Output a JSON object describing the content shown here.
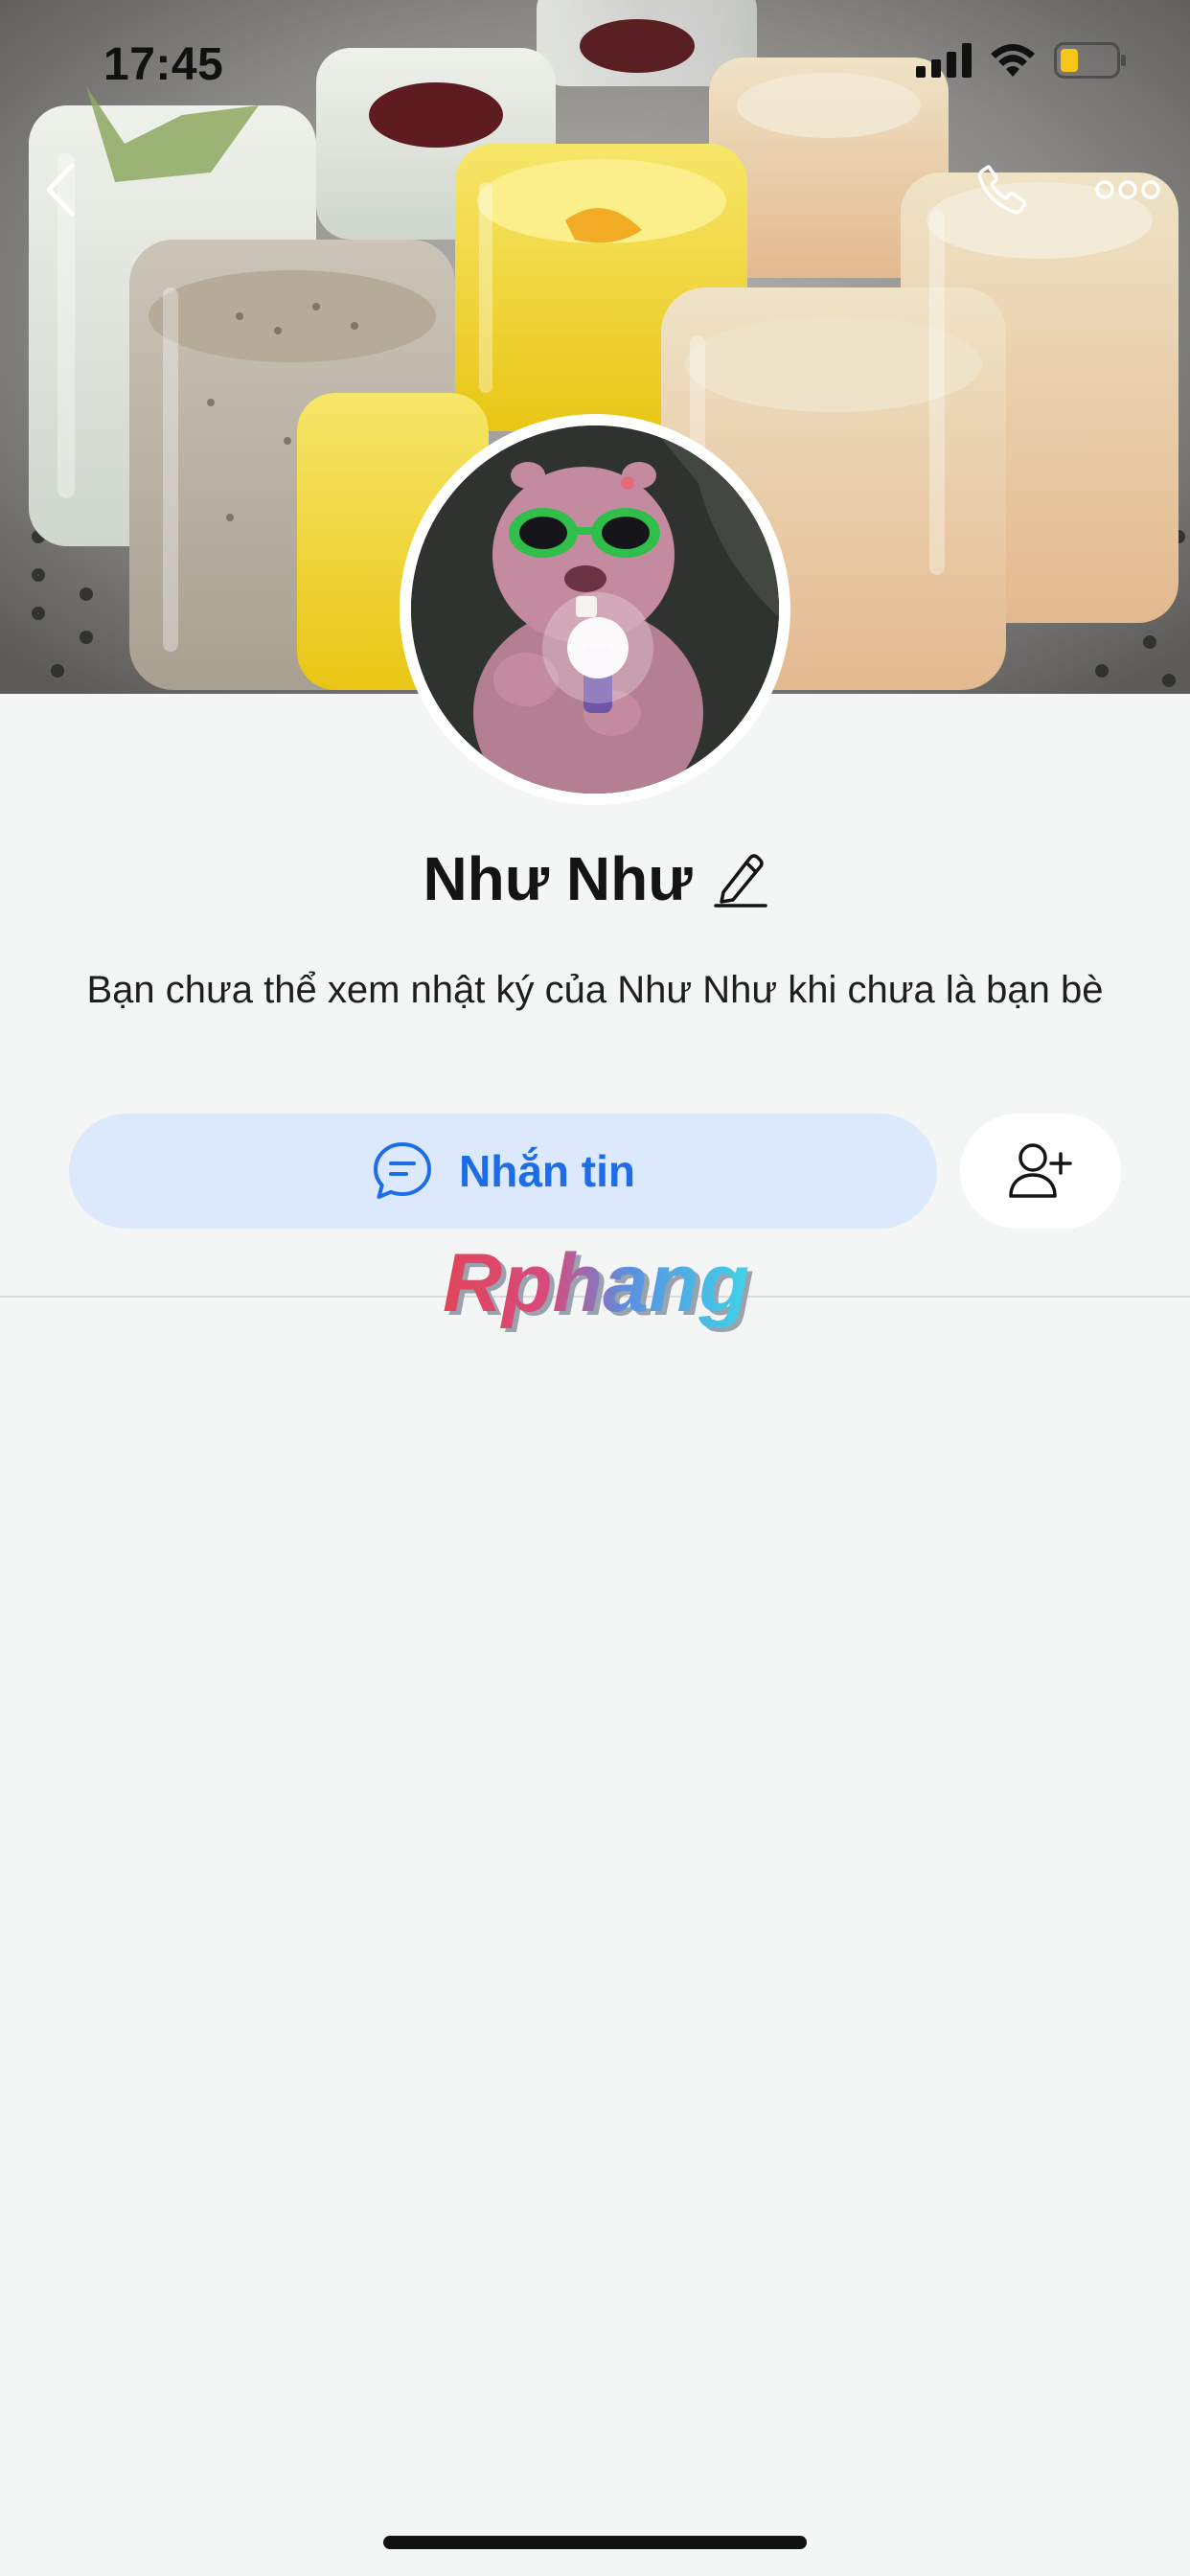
{
  "status_bar": {
    "time": "17:45"
  },
  "header": {
    "back_icon": "chevron-left-icon",
    "call_icon": "phone-icon",
    "more_icon": "more-horizontal-icon"
  },
  "profile": {
    "name": "Như Như",
    "edit_icon": "pencil-icon",
    "privacy_note": "Bạn chưa thể xem nhật ký của Như Như khi chưa là bạn bè"
  },
  "actions": {
    "message_label": "Nhắn tin",
    "message_icon": "chat-bubble-icon",
    "add_friend_icon": "add-user-icon"
  },
  "watermark": {
    "text": "Rphang"
  },
  "colors": {
    "accent": "#1d6ee6",
    "message_button_bg": "#dce8fb",
    "page_bg": "#f4f6f6",
    "battery_low": "#f5c518"
  }
}
